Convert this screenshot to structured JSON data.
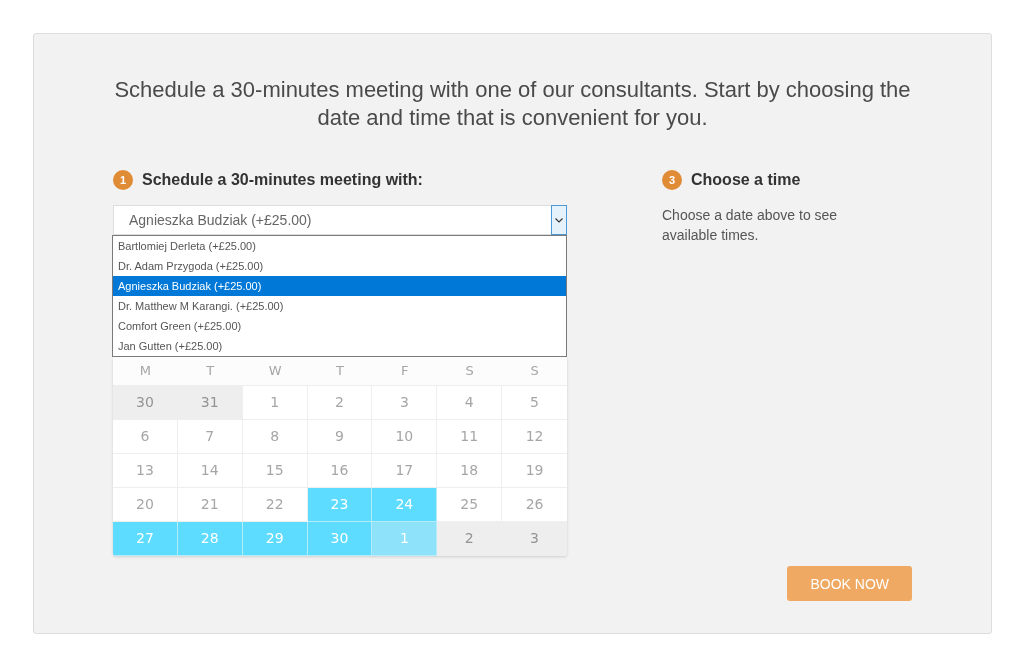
{
  "intro": "Schedule a 30-minutes meeting with one of our consultants. Start by choosing the date and time that is convenient for you.",
  "consultant_step": {
    "number": "1",
    "title": "Schedule a 30-minutes meeting with:",
    "select": {
      "value": "Agnieszka Budziak (+£25.00)",
      "expanded": true,
      "options": [
        {
          "label": "Bartlomiej Derleta (+£25.00)",
          "selected": false
        },
        {
          "label": "Dr. Adam Przygoda (+£25.00)",
          "selected": false
        },
        {
          "label": "Agnieszka Budziak (+£25.00)",
          "selected": true
        },
        {
          "label": "Dr. Matthew M Karangi. (+£25.00)",
          "selected": false
        },
        {
          "label": "Comfort Green (+£25.00)",
          "selected": false
        },
        {
          "label": "Jan Gutten (+£25.00)",
          "selected": false
        }
      ]
    }
  },
  "calendar": {
    "weekdays": [
      "M",
      "T",
      "W",
      "T",
      "F",
      "S",
      "S"
    ],
    "weeks": [
      [
        {
          "day": "30",
          "outside_month": true,
          "available": false
        },
        {
          "day": "31",
          "outside_month": true,
          "available": false
        },
        {
          "day": "1",
          "outside_month": false,
          "available": false
        },
        {
          "day": "2",
          "outside_month": false,
          "available": false
        },
        {
          "day": "3",
          "outside_month": false,
          "available": false
        },
        {
          "day": "4",
          "outside_month": false,
          "available": false
        },
        {
          "day": "5",
          "outside_month": false,
          "available": false
        }
      ],
      [
        {
          "day": "6",
          "outside_month": false,
          "available": false
        },
        {
          "day": "7",
          "outside_month": false,
          "available": false
        },
        {
          "day": "8",
          "outside_month": false,
          "available": false
        },
        {
          "day": "9",
          "outside_month": false,
          "available": false
        },
        {
          "day": "10",
          "outside_month": false,
          "available": false
        },
        {
          "day": "11",
          "outside_month": false,
          "available": false
        },
        {
          "day": "12",
          "outside_month": false,
          "available": false
        }
      ],
      [
        {
          "day": "13",
          "outside_month": false,
          "available": false
        },
        {
          "day": "14",
          "outside_month": false,
          "available": false
        },
        {
          "day": "15",
          "outside_month": false,
          "available": false
        },
        {
          "day": "16",
          "outside_month": false,
          "available": false
        },
        {
          "day": "17",
          "outside_month": false,
          "available": false
        },
        {
          "day": "18",
          "outside_month": false,
          "available": false
        },
        {
          "day": "19",
          "outside_month": false,
          "available": false
        }
      ],
      [
        {
          "day": "20",
          "outside_month": false,
          "available": false
        },
        {
          "day": "21",
          "outside_month": false,
          "available": false
        },
        {
          "day": "22",
          "outside_month": false,
          "available": false
        },
        {
          "day": "23",
          "outside_month": false,
          "available": true
        },
        {
          "day": "24",
          "outside_month": false,
          "available": true
        },
        {
          "day": "25",
          "outside_month": false,
          "available": false
        },
        {
          "day": "26",
          "outside_month": false,
          "available": false
        }
      ],
      [
        {
          "day": "27",
          "outside_month": false,
          "available": true
        },
        {
          "day": "28",
          "outside_month": false,
          "available": true
        },
        {
          "day": "29",
          "outside_month": false,
          "available": true
        },
        {
          "day": "30",
          "outside_month": false,
          "available": true
        },
        {
          "day": "1",
          "outside_month": true,
          "available": true
        },
        {
          "day": "2",
          "outside_month": true,
          "available": false
        },
        {
          "day": "3",
          "outside_month": true,
          "available": false
        }
      ]
    ]
  },
  "time_step": {
    "number": "3",
    "title": "Choose a time",
    "message": "Choose a date above to see available times."
  },
  "book_button": {
    "label": "BOOK NOW"
  }
}
